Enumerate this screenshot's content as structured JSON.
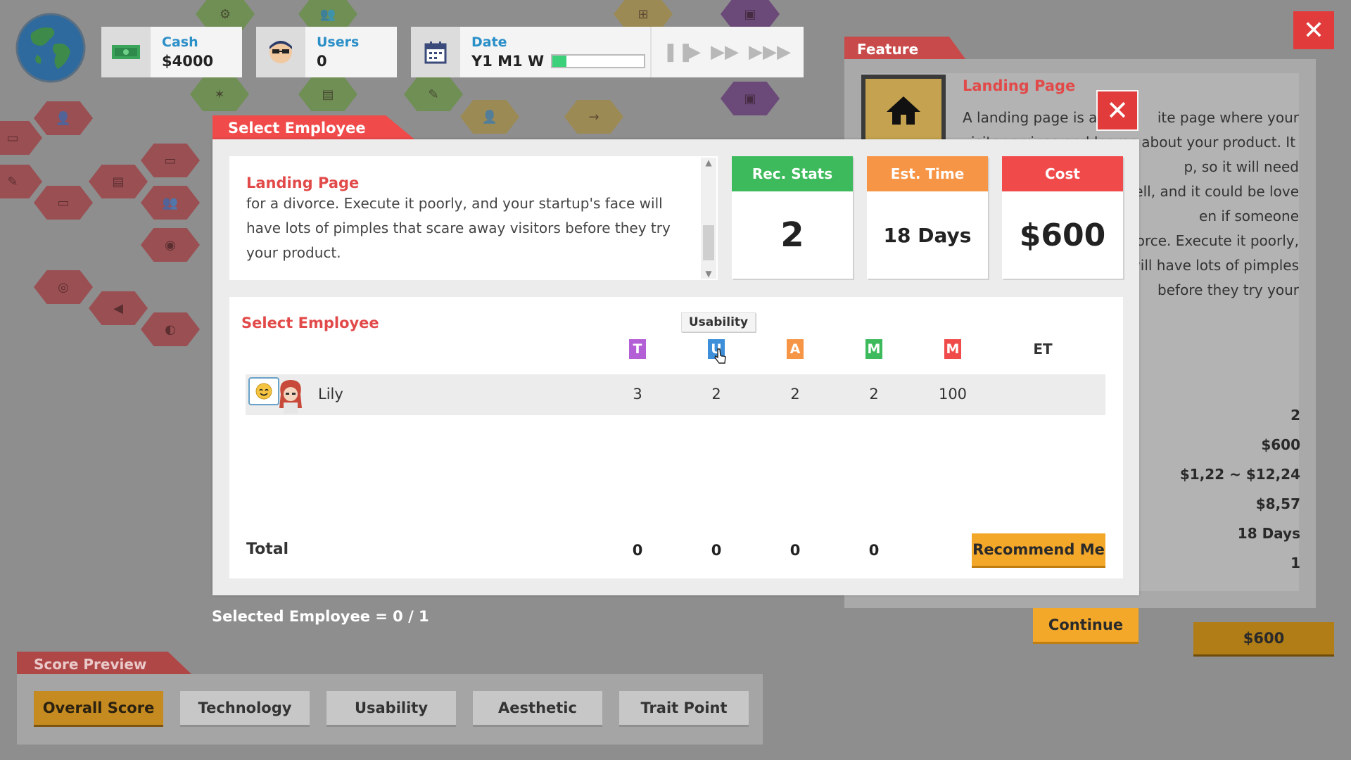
{
  "hud": {
    "cash_label": "Cash",
    "cash_value": "$4000",
    "users_label": "Users",
    "users_value": "0",
    "date_label": "Date",
    "date_value": "Y1 M1 W",
    "progress": 0.15
  },
  "feature_panel": {
    "tab_label": "Feature",
    "title": "Landing Page",
    "text_lines": [
      "A landing page is a",
      "ite page where your",
      "visitor arrives and learns about your product. It",
      "p, so it will need",
      "well, and it could be love",
      "en if someone",
      "orce. Execute it poorly,",
      "will have lots of pimples",
      "before they try your"
    ],
    "values": [
      "2",
      "$600",
      "$1,22 ~ $12,24",
      "$8,57",
      "18 Days",
      "1"
    ],
    "continue_label": "Continue",
    "price_button": "$600"
  },
  "modal": {
    "tab_title": "Select Employee",
    "description": {
      "title": "Landing Page",
      "lines": [
        "for a divorce. Execute it poorly, and your startup's face will",
        "have lots of pimples that scare away visitors before they try",
        "your product."
      ]
    },
    "stats": {
      "rec_label": "Rec. Stats",
      "rec_value": "2",
      "time_label": "Est. Time",
      "time_value": "18 Days",
      "cost_label": "Cost",
      "cost_value": "$600"
    },
    "table": {
      "title": "Select Employee",
      "tooltip": "Usability",
      "columns": [
        "T",
        "U",
        "A",
        "M",
        "M",
        "ET"
      ],
      "employee": {
        "name": "Lily",
        "values": [
          "3",
          "2",
          "2",
          "2",
          "100"
        ]
      },
      "total_label": "Total",
      "totals": [
        "0",
        "0",
        "0",
        "0"
      ],
      "recommend_label": "Recommend Me"
    }
  },
  "selected_text": "Selected Employee = 0 / 1",
  "score_preview": {
    "title": "Score Preview",
    "buttons": [
      "Overall Score",
      "Technology",
      "Usability",
      "Aesthetic",
      "Trait Point"
    ]
  },
  "colors": {
    "accent_red": "#f04a4a",
    "rec_green": "#3dbb5c",
    "time_orange": "#f79546",
    "cost_red": "#f04a4a",
    "col_T": "#b35fd6",
    "col_U": "#3d8fd9",
    "col_A": "#f79546",
    "col_M1": "#3dbb5c",
    "col_M2": "#f04a4a"
  }
}
